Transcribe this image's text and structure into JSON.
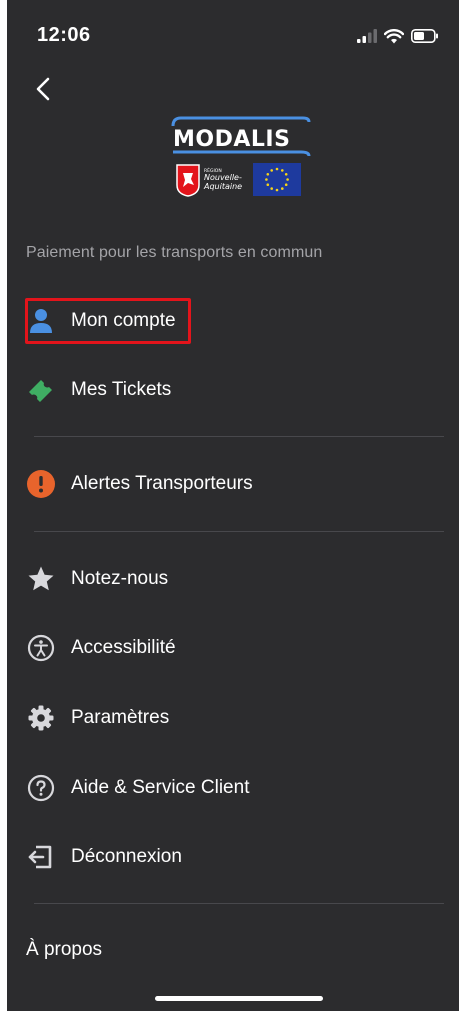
{
  "status": {
    "time": "12:06"
  },
  "branding": {
    "logo_text": "MODALIS",
    "region_label_small": "RÉGION",
    "region_label_line1": "Nouvelle-",
    "region_label_line2": "Aquitaine"
  },
  "subtitle": "Paiement pour les transports en commun",
  "menu": [
    {
      "label": "Mon compte",
      "icon": "user-icon",
      "highlighted": true
    },
    {
      "label": "Mes Tickets",
      "icon": "ticket-icon"
    },
    {
      "label": "Alertes Transporteurs",
      "icon": "alert-icon"
    },
    {
      "label": "Notez-nous",
      "icon": "star-icon"
    },
    {
      "label": "Accessibilité",
      "icon": "accessibility-icon"
    },
    {
      "label": "Paramètres",
      "icon": "gear-icon"
    },
    {
      "label": "Aide & Service Client",
      "icon": "help-icon"
    },
    {
      "label": "Déconnexion",
      "icon": "logout-icon"
    }
  ],
  "about": "À propos",
  "colors": {
    "background": "#2c2c2e",
    "accent_blue": "#4a90e2",
    "ticket_green": "#3fae63",
    "alert_orange": "#e8642c",
    "highlight_red": "#e3141b"
  }
}
